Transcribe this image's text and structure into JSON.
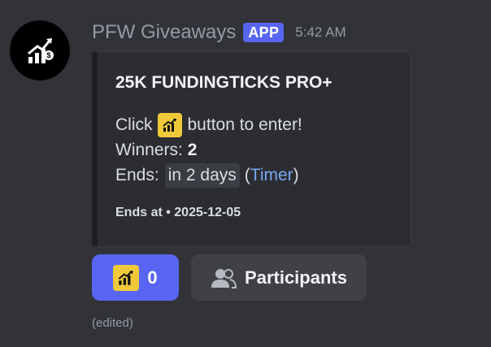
{
  "author": {
    "name": "PFW Giveaways",
    "badge": "APP",
    "timestamp": "5:42 AM",
    "avatar_icon": "chart-arrow-icon"
  },
  "embed": {
    "title": "25K FUNDINGTICKS PRO+",
    "click_prefix": "Click",
    "click_suffix": "button to enter!",
    "winners_label": "Winners:",
    "winners_value": "2",
    "ends_label": "Ends:",
    "ends_value": "in 2 days",
    "paren_open": "(",
    "timer_link": "Timer",
    "paren_close": ")",
    "footer": "Ends at • 2025-12-05",
    "emoji_icon": "chart-arrow-emoji"
  },
  "buttons": {
    "enter_count": "0",
    "participants_label": "Participants"
  },
  "status": {
    "edited": "(edited)"
  },
  "colors": {
    "background": "#313338",
    "accent": "#5865f2",
    "link": "#7ba7f5",
    "emoji_bg": "#f0c93a"
  }
}
